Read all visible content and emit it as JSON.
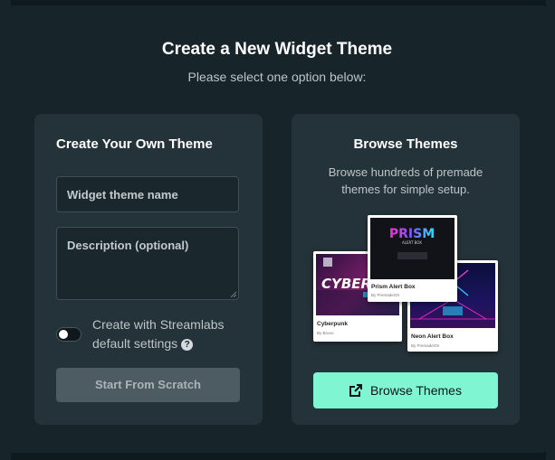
{
  "modal": {
    "title": "Create a New Widget Theme",
    "subtitle": "Please select one option below:"
  },
  "create_card": {
    "heading": "Create Your Own Theme",
    "name_placeholder": "Widget theme name",
    "description_placeholder": "Description (optional)",
    "toggle_label": "Create with Streamlabs default settings",
    "toggle_on": false,
    "help_icon": "question-mark-icon",
    "scratch_button": "Start From Scratch"
  },
  "browse_card": {
    "heading": "Browse Themes",
    "description": "Browse hundreds of premade themes for simple setup.",
    "button_label": "Browse Themes",
    "button_icon": "external-link-icon",
    "themes": [
      {
        "name": "Cyberpunk",
        "author": "By Bruno",
        "preview_text": "CYBERP"
      },
      {
        "name": "Prism Alert Box",
        "author": "By PremadeOS",
        "preview_text": "PRISM",
        "preview_sub": "ALERT BOX"
      },
      {
        "name": "Neon Alert Box",
        "author": "By PremadeOS"
      }
    ]
  },
  "colors": {
    "accent": "#80f5d2",
    "modal_bg": "#17242a",
    "card_bg": "#243339",
    "disabled_button": "#4c5c62"
  }
}
